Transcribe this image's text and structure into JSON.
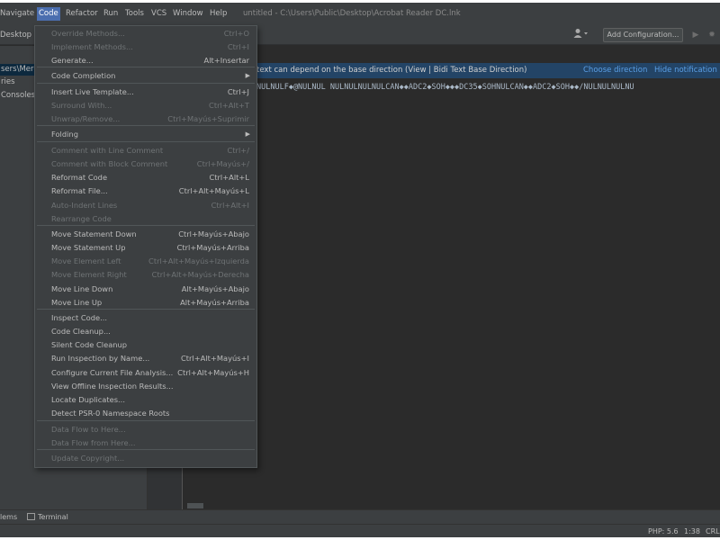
{
  "window": {
    "title": "untitled - C:\\Users\\Public\\Desktop\\Acrobat Reader DC.lnk"
  },
  "menubar": {
    "navigate": "Navigate",
    "code": "Code",
    "refactor": "Refactor",
    "run": "Run",
    "tools": "Tools",
    "vcs": "VCS",
    "window": "Window",
    "help": "Help"
  },
  "toolbar": {
    "breadcrumb": "Desktop",
    "add_configuration": "Add Configuration...",
    "icons": [
      "user-icon",
      "run-icon",
      "debug-icon"
    ]
  },
  "sidebar": {
    "items": [
      "sers\\Merch",
      "ries",
      "Consoles"
    ]
  },
  "notification": {
    "text": "text can depend on the base direction (View | Bidi Text Base Direction)",
    "choose": "Choose direction",
    "hide": "Hide notification"
  },
  "editor": {
    "line": "NULNULF◆@NULNUL  NULNULNULNULCAN◆◆ADC2◆SOH◆◆◆DC35◆SOHNULCAN◆◆ADC2◆SOH◆◆/NULNULNULNU"
  },
  "code_menu": {
    "items": [
      {
        "label": "Override Methods...",
        "shortcut": "Ctrl+O",
        "disabled": true
      },
      {
        "label": "Implement Methods...",
        "shortcut": "Ctrl+I",
        "disabled": true
      },
      {
        "label": "Generate...",
        "shortcut": "Alt+Insertar",
        "disabled": false
      },
      {
        "label": "Code Completion",
        "shortcut": "",
        "disabled": false,
        "submenu": true
      },
      {
        "label": "Insert Live Template...",
        "shortcut": "Ctrl+J",
        "disabled": false
      },
      {
        "label": "Surround With...",
        "shortcut": "Ctrl+Alt+T",
        "disabled": true
      },
      {
        "label": "Unwrap/Remove...",
        "shortcut": "Ctrl+Mayús+Suprimir",
        "disabled": true
      },
      {
        "label": "Folding",
        "shortcut": "",
        "disabled": false,
        "submenu": true
      },
      {
        "label": "Comment with Line Comment",
        "shortcut": "Ctrl+/",
        "disabled": true
      },
      {
        "label": "Comment with Block Comment",
        "shortcut": "Ctrl+Mayús+/",
        "disabled": true
      },
      {
        "label": "Reformat Code",
        "shortcut": "Ctrl+Alt+L",
        "disabled": false
      },
      {
        "label": "Reformat File...",
        "shortcut": "Ctrl+Alt+Mayús+L",
        "disabled": false
      },
      {
        "label": "Auto-Indent Lines",
        "shortcut": "Ctrl+Alt+I",
        "disabled": true
      },
      {
        "label": "Rearrange Code",
        "shortcut": "",
        "disabled": true
      },
      {
        "label": "Move Statement Down",
        "shortcut": "Ctrl+Mayús+Abajo",
        "disabled": false
      },
      {
        "label": "Move Statement Up",
        "shortcut": "Ctrl+Mayús+Arriba",
        "disabled": false
      },
      {
        "label": "Move Element Left",
        "shortcut": "Ctrl+Alt+Mayús+Izquierda",
        "disabled": true
      },
      {
        "label": "Move Element Right",
        "shortcut": "Ctrl+Alt+Mayús+Derecha",
        "disabled": true
      },
      {
        "label": "Move Line Down",
        "shortcut": "Alt+Mayús+Abajo",
        "disabled": false
      },
      {
        "label": "Move Line Up",
        "shortcut": "Alt+Mayús+Arriba",
        "disabled": false
      },
      {
        "label": "Inspect Code...",
        "shortcut": "",
        "disabled": false
      },
      {
        "label": "Code Cleanup...",
        "shortcut": "",
        "disabled": false
      },
      {
        "label": "Silent Code Cleanup",
        "shortcut": "",
        "disabled": false
      },
      {
        "label": "Run Inspection by Name...",
        "shortcut": "Ctrl+Alt+Mayús+I",
        "disabled": false
      },
      {
        "label": "Configure Current File Analysis...",
        "shortcut": "Ctrl+Alt+Mayús+H",
        "disabled": false
      },
      {
        "label": "View Offline Inspection Results...",
        "shortcut": "",
        "disabled": false
      },
      {
        "label": "Locate Duplicates...",
        "shortcut": "",
        "disabled": false
      },
      {
        "label": "Detect PSR-0 Namespace Roots",
        "shortcut": "",
        "disabled": false
      },
      {
        "label": "Data Flow to Here...",
        "shortcut": "",
        "disabled": true
      },
      {
        "label": "Data Flow from Here...",
        "shortcut": "",
        "disabled": true
      },
      {
        "label": "Update Copyright...",
        "shortcut": "",
        "disabled": true
      }
    ]
  },
  "bottom_tabs": {
    "problems": "lems",
    "terminal": "Terminal"
  },
  "status": {
    "php": "PHP: 5.6",
    "position": "1:38",
    "line_sep": "CRL"
  }
}
